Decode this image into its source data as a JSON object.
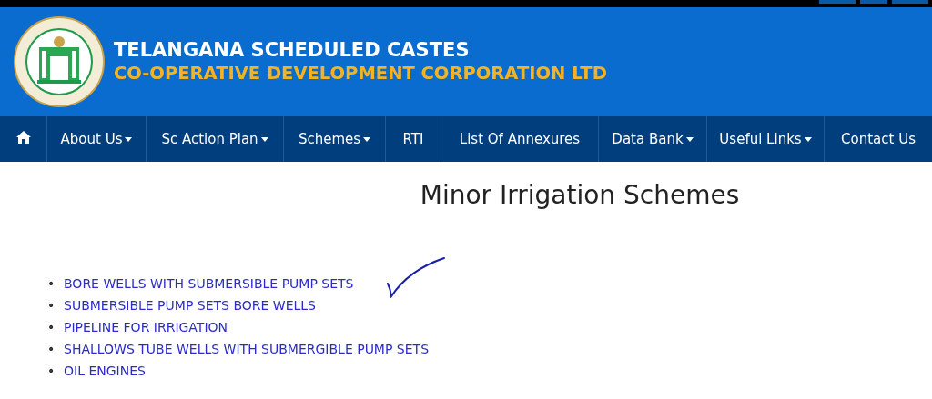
{
  "header": {
    "title_line_1": "TELANGANA SCHEDULED CASTES",
    "title_line_2": "CO-OPERATIVE DEVELOPMENT CORPORATION LTD"
  },
  "nav": [
    {
      "kind": "home",
      "dropdown": false
    },
    {
      "kind": "text",
      "label": "About Us",
      "dropdown": true
    },
    {
      "kind": "text",
      "label": "Sc Action Plan",
      "dropdown": true
    },
    {
      "kind": "text",
      "label": "Schemes",
      "dropdown": true
    },
    {
      "kind": "text",
      "label": "RTI",
      "dropdown": false
    },
    {
      "kind": "text",
      "label": "List Of Annexures",
      "dropdown": false
    },
    {
      "kind": "text",
      "label": "Data Bank",
      "dropdown": true
    },
    {
      "kind": "text",
      "label": "Useful Links",
      "dropdown": true
    },
    {
      "kind": "text",
      "label": "Contact Us",
      "dropdown": false
    }
  ],
  "page_title": "Minor Irrigation Schemes",
  "schemes": [
    {
      "bullet": "•",
      "label": "BORE WELLS WITH SUBMERSIBLE PUMP SETS",
      "ticked": true
    },
    {
      "bullet": "•",
      "label": "SUBMERSIBLE PUMP SETS BORE WELLS",
      "ticked": false
    },
    {
      "bullet": "•",
      "label": "PIPELINE FOR IRRIGATION",
      "ticked": false
    },
    {
      "bullet": "•",
      "label": "SHALLOWS TUBE WELLS WITH SUBMERGIBLE PUMP SETS",
      "ticked": false
    },
    {
      "bullet": "•",
      "label": "OIL ENGINES",
      "ticked": false
    }
  ]
}
